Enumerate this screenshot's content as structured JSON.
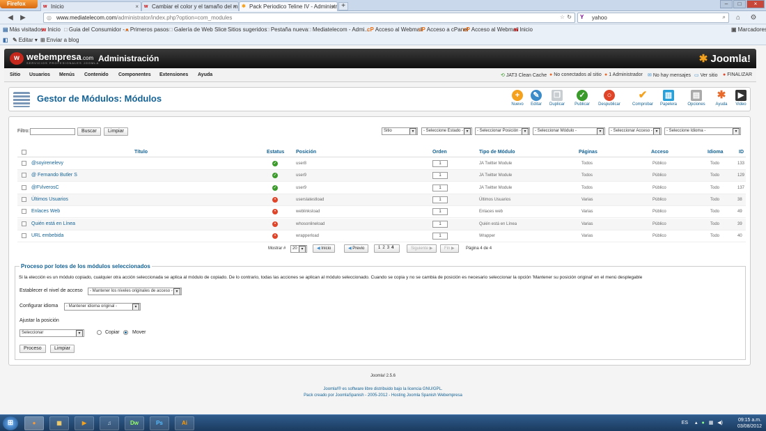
{
  "browser": {
    "menu_button": "Firefox",
    "tabs": [
      {
        "label": "Inicio"
      },
      {
        "label": "Cambiar el color y el tamaño del men..."
      },
      {
        "label": "Pack Periodico Teline IV - Administra..."
      }
    ],
    "url_host": "www.mediatelecom.com",
    "url_path": "/administrator/index.php?option=com_modules",
    "search_value": "yahoo",
    "bookmarks": [
      "Más visitados",
      "Inicio",
      "Guia del Consumidor -...",
      "Primeros pasos",
      "Galería de Web Slice",
      "Sitios sugeridos",
      "Pestaña nueva",
      "Mediatelecom - Admi...",
      "Acceso al Webmail",
      "Acceso a cPanel",
      "Acceso al Webmail",
      "Inicio"
    ],
    "bookmarks_right": "Marcadores",
    "toolbar2": [
      "Editar",
      "Enviar a blog"
    ]
  },
  "header": {
    "brand": "webempresa",
    "brand_suffix": ".com",
    "brand_sub": "SERVICIOS PROFESIONALES JOOMLA",
    "admin_title": "Administración",
    "joomla_logo": "Joomla!"
  },
  "menu": [
    "Sitio",
    "Usuarios",
    "Menús",
    "Contenido",
    "Componentes",
    "Extensiones",
    "Ayuda"
  ],
  "status": [
    "JAT3 Clean Cache",
    "No conectados al sitio",
    "1 Administrador",
    "No hay mensajes",
    "Ver sitio",
    "FINALIZAR"
  ],
  "page_title": "Gestor de Módulos: Módulos",
  "toolbar": [
    {
      "label": "Nuevo",
      "icon": "plus-icon",
      "color": "#f4a11e"
    },
    {
      "label": "Editar",
      "icon": "edit-icon",
      "color": "#3b8bc9"
    },
    {
      "label": "Duplicar",
      "icon": "copy-icon",
      "color": "#a0a8b0"
    },
    {
      "label": "Publicar",
      "icon": "check-icon",
      "color": "#3a9a2a"
    },
    {
      "label": "Despublicar",
      "icon": "unpublish-icon",
      "color": "#e0452a"
    },
    {
      "label": "Comprobar",
      "icon": "checkin-icon",
      "color": "#f4a11e"
    },
    {
      "label": "Papelera",
      "icon": "trash-icon",
      "color": "#2aa0d8"
    },
    {
      "label": "Opciones",
      "icon": "options-icon",
      "color": "#7a7a7a"
    },
    {
      "label": "Ayuda",
      "icon": "help-icon",
      "color": "#e8692a"
    },
    {
      "label": "Video",
      "icon": "video-icon",
      "color": "#333333"
    }
  ],
  "filter": {
    "label": "Filtro:",
    "value": "",
    "search_button": "Buscar",
    "clear_button": "Limpiar",
    "selects": [
      "Sitio",
      "- Seleccione Estado -",
      "- Seleccionar Posición -",
      "- Seleccionar Módulo -",
      "- Seleccionar Acceso -",
      "- Seleccione Idioma -"
    ]
  },
  "table": {
    "headers": [
      "Título",
      "Estatus",
      "Posición",
      "Orden",
      "Tipo de Módulo",
      "Páginas",
      "Acceso",
      "Idioma",
      "ID"
    ],
    "rows": [
      {
        "title": "@soyirenelevy",
        "status": "published",
        "position": "user8",
        "order": "1",
        "type": "JA Twitter Module",
        "pages": "Todos",
        "access": "Público",
        "language": "Todo",
        "id": "133"
      },
      {
        "title": "@ Fernando Butler S",
        "status": "published",
        "position": "user9",
        "order": "1",
        "type": "JA Twitter Module",
        "pages": "Todos",
        "access": "Público",
        "language": "Todo",
        "id": "129"
      },
      {
        "title": "@FViverosC",
        "status": "published",
        "position": "user9",
        "order": "1",
        "type": "JA Twitter Module",
        "pages": "Todos",
        "access": "Público",
        "language": "Todo",
        "id": "137"
      },
      {
        "title": "Últimos Usuarios",
        "status": "unpublished",
        "position": "userslatestload",
        "order": "1",
        "type": "Últimos Usuarios",
        "pages": "Varias",
        "access": "Público",
        "language": "Todo",
        "id": "38"
      },
      {
        "title": "Enlaces Web",
        "status": "unpublished",
        "position": "weblinksload",
        "order": "1",
        "type": "Enlaces web",
        "pages": "Varias",
        "access": "Público",
        "language": "Todo",
        "id": "49"
      },
      {
        "title": "Quién está en Línea",
        "status": "unpublished",
        "position": "whosonlineload",
        "order": "1",
        "type": "Quién está en Línea",
        "pages": "Varias",
        "access": "Público",
        "language": "Todo",
        "id": "39"
      },
      {
        "title": "URL embebida",
        "status": "unpublished",
        "position": "wrapperload",
        "order": "1",
        "type": "Wrapper",
        "pages": "Varias",
        "access": "Público",
        "language": "Todo",
        "id": "40"
      }
    ]
  },
  "pagination": {
    "show_label": "Mostrar #",
    "show_value": "20",
    "start": "Inicio",
    "prev": "Previo",
    "pages": [
      "1",
      "2",
      "3",
      "4"
    ],
    "next": "Siguiente",
    "end": "Fin",
    "page_info": "Página 4 de 4"
  },
  "batch": {
    "title": "Proceso por lotes de los módulos seleccionados",
    "description": "Si la elección es un módulo copiado, cualquier otra acción seleccionada se aplica al módulo de copiado. De lo contrario, todas las acciones se aplican al módulo seleccionado. Cuando se copia y no se cambia de posición es necesario seleccionar la opción 'Mantener su posición original' en el menú desplegable",
    "access_label": "Establecer el nivel de acceso",
    "access_value": "- Mantener los niveles originales de acceso -",
    "language_label": "Configurar idioma",
    "language_value": "- Mantener idioma original -",
    "position_label": "Ajustar la posición",
    "position_value": "Seleccionar",
    "copy_label": "Copiar",
    "move_label": "Mover",
    "process_button": "Proceso",
    "clear_button": "Limpiar"
  },
  "footer": {
    "version": "Joomla! 2.5.6",
    "license": "Joomla!® es software libre distribuido bajo la licencia GNU/GPL.",
    "credits": "Pack creado por JoomlaSpanish - 2005-2012 - Hosting Joomla Spanish Webempresa"
  },
  "taskbar": {
    "apps": [
      "firefox-icon",
      "explorer-icon",
      "media-icon",
      "itunes-icon",
      "Dw",
      "Ps",
      "Ai"
    ],
    "lang": "ES",
    "time": "09:15 a.m.",
    "date": "03/08/2012"
  }
}
